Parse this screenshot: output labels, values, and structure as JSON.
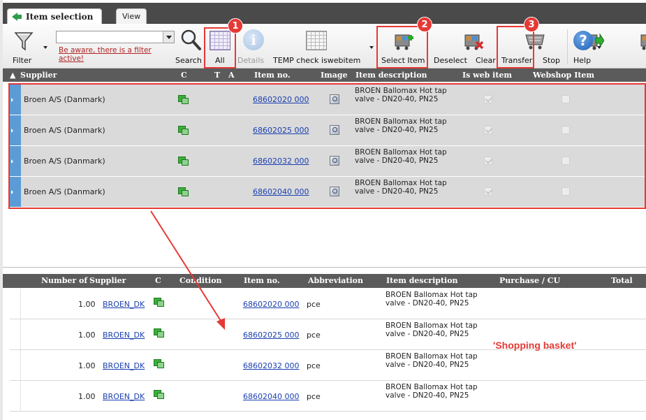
{
  "tabs": {
    "main": "Item selection",
    "view": "View"
  },
  "toolbar": {
    "filter_label": "Filter",
    "search_value": "",
    "filter_warning": "Be aware, there is a filter active!",
    "search_label": "Search",
    "all_label": "All",
    "details_label": "Details",
    "temp_label": "TEMP check iswebitem",
    "select_label": "Select Item",
    "deselect_label": "Deselect",
    "clear_label": "Clear",
    "transfer_label": "Transfer",
    "stop_label": "Stop",
    "help_label": "Help"
  },
  "annotations": {
    "badge1": "1",
    "badge2": "2",
    "badge3": "3",
    "basket_note": "'Shopping basket'"
  },
  "upper_grid": {
    "columns": {
      "supplier": "Supplier",
      "c": "C",
      "t": "T",
      "a": "A",
      "item_no": "Item no.",
      "image": "Image",
      "description": "Item description",
      "is_web_item": "Is web item",
      "webshop_item": "Webshop Item"
    },
    "rows": [
      {
        "supplier": "Broen A/S (Danmark)",
        "item_no": "68602020 000",
        "description": "BROEN Ballomax Hot tap valve - DN20-40, PN25",
        "is_web_item": true,
        "webshop_item": false
      },
      {
        "supplier": "Broen A/S (Danmark)",
        "item_no": "68602025 000",
        "description": "BROEN Ballomax Hot tap valve - DN20-40, PN25",
        "is_web_item": true,
        "webshop_item": false
      },
      {
        "supplier": "Broen A/S (Danmark)",
        "item_no": "68602032 000",
        "description": "BROEN Ballomax Hot tap valve - DN20-40, PN25",
        "is_web_item": true,
        "webshop_item": false
      },
      {
        "supplier": "Broen A/S (Danmark)",
        "item_no": "68602040 000",
        "description": "BROEN Ballomax Hot tap valve - DN20-40, PN25",
        "is_web_item": true,
        "webshop_item": false
      }
    ]
  },
  "lower_grid": {
    "columns": {
      "number_of": "Number of",
      "supplier": "Supplier",
      "c": "C",
      "condition": "Condition",
      "item_no": "Item no.",
      "abbreviation": "Abbreviation",
      "description": "Item description",
      "purchase_cu": "Purchase / CU",
      "total": "Total"
    },
    "rows": [
      {
        "number_of": "1.00",
        "supplier": "BROEN_DK",
        "item_no": "68602020 000",
        "abbreviation": "pce",
        "description": "BROEN Ballomax Hot tap valve - DN20-40, PN25"
      },
      {
        "number_of": "1.00",
        "supplier": "BROEN_DK",
        "item_no": "68602025 000",
        "abbreviation": "pce",
        "description": "BROEN Ballomax Hot tap valve - DN20-40, PN25"
      },
      {
        "number_of": "1.00",
        "supplier": "BROEN_DK",
        "item_no": "68602032 000",
        "abbreviation": "pce",
        "description": "BROEN Ballomax Hot tap valve - DN20-40, PN25"
      },
      {
        "number_of": "1.00",
        "supplier": "BROEN_DK",
        "item_no": "68602040 000",
        "abbreviation": "pce",
        "description": "BROEN Ballomax Hot tap valve - DN20-40, PN25"
      }
    ]
  },
  "colors": {
    "annotation_red": "#e53935",
    "header_gray": "#5b5b5b",
    "row_marker_blue": "#5c9bd6",
    "stock_green": "#3cae3c"
  },
  "icons": [
    "back-arrow-icon",
    "filter-funnel-icon",
    "magnifier-icon",
    "grid-all-icon",
    "info-icon",
    "table-icon",
    "cart-add-icon",
    "cart-remove-icon",
    "cart-clear-icon",
    "cart-transfer-icon",
    "stop-icon",
    "help-icon",
    "stock-icon",
    "image-icon"
  ]
}
